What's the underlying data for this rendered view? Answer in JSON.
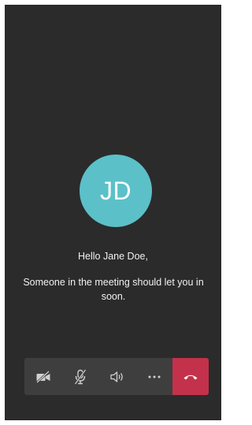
{
  "participant": {
    "initials": "JD",
    "avatar_color": "#5cc0c9"
  },
  "lobby": {
    "greeting": "Hello Jane Doe,",
    "message": "Someone in the meeting should let you in soon."
  },
  "controls": {
    "camera_icon": "video-off-icon",
    "mic_icon": "mic-off-icon",
    "speaker_icon": "speaker-icon",
    "more_icon": "more-horizontal-icon",
    "hangup_icon": "phone-hangup-icon",
    "hangup_color": "#c4314b"
  }
}
